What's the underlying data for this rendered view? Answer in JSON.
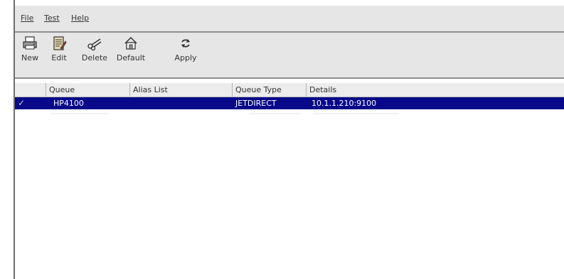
{
  "menu": {
    "file": "File",
    "test": "Test",
    "help": "Help"
  },
  "toolbar": {
    "new": {
      "label": "New",
      "icon": "printer-icon"
    },
    "edit": {
      "label": "Edit",
      "icon": "edit-document-icon"
    },
    "delete": {
      "label": "Delete",
      "icon": "scissors-icon"
    },
    "default": {
      "label": "Default",
      "icon": "home-icon"
    },
    "apply": {
      "label": "Apply",
      "icon": "refresh-icon"
    }
  },
  "table": {
    "columns": {
      "status": "",
      "queue": "Queue",
      "alias": "Alias List",
      "type": "Queue Type",
      "details": "Details"
    },
    "rows": [
      {
        "status": "✓",
        "queue": "HP4100",
        "alias": "",
        "type": "JETDIRECT",
        "details": "10.1.1.210:9100",
        "selected": true
      }
    ]
  },
  "colors": {
    "selection": "#08088a",
    "chrome": "#e6e6e6",
    "border": "#8e8e8e"
  }
}
